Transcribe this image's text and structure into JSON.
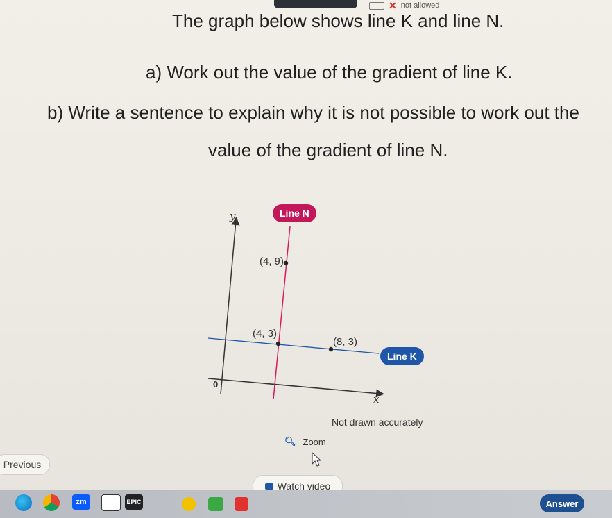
{
  "status": {
    "text": "not allowed"
  },
  "question": {
    "title": "The graph below shows line K and line N.",
    "part_a": "a) Work out the value of the gradient of line K.",
    "part_b_line1": "b) Write a sentence to explain why it is not possible to work out the",
    "part_b_line2": "value of the gradient of line N."
  },
  "graph": {
    "y_label": "y",
    "x_label": "x",
    "origin_label": "0",
    "line_n_label": "Line N",
    "line_k_label": "Line K",
    "points": [
      {
        "label": "(4, 9)",
        "x": 4,
        "y": 9
      },
      {
        "label": "(4, 3)",
        "x": 4,
        "y": 3
      },
      {
        "label": "(8, 3)",
        "x": 8,
        "y": 3
      }
    ],
    "note": "Not drawn accurately",
    "colors": {
      "line_n": "#d81b60",
      "line_k": "#1f56a8",
      "axis": "#333333"
    }
  },
  "controls": {
    "zoom_label": "Zoom",
    "previous_label": "Previous",
    "video_label": "Watch video",
    "answer_label": "Answer"
  },
  "taskbar": {
    "zm_label": "zm",
    "epic_label": "EPIC"
  }
}
